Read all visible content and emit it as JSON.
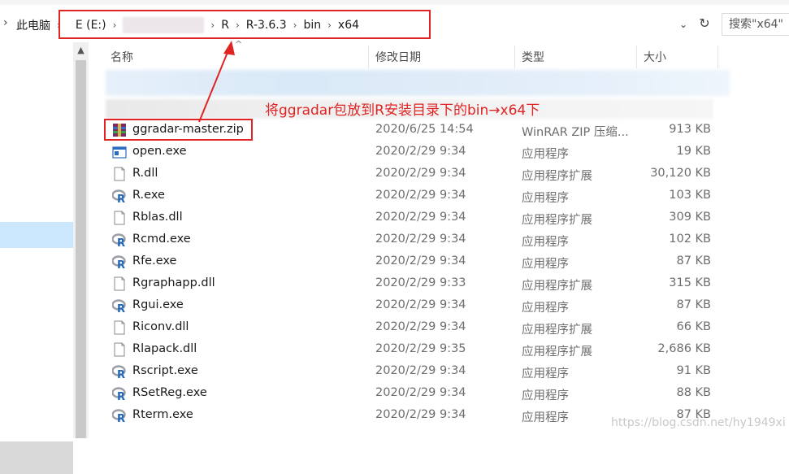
{
  "address_bar": {
    "crumbs": [
      "此电脑",
      "E (E:)",
      "R",
      "R-3.6.3",
      "bin",
      "x64"
    ],
    "search_placeholder": "搜索\"x64\""
  },
  "columns": {
    "name": "名称",
    "date": "修改日期",
    "type": "类型",
    "size": "大小"
  },
  "annotation": "将ggradar包放到R安装目录下的bin→x64下",
  "files": [
    {
      "name": "ggradar-master.zip",
      "date": "2020/6/25 14:54",
      "type": "WinRAR ZIP 压缩...",
      "size": "913 KB",
      "icon": "winrar-zip-icon"
    },
    {
      "name": "open.exe",
      "date": "2020/2/29 9:34",
      "type": "应用程序",
      "size": "19 KB",
      "icon": "window-exe-icon"
    },
    {
      "name": "R.dll",
      "date": "2020/2/29 9:34",
      "type": "应用程序扩展",
      "size": "30,120 KB",
      "icon": "dll-file-icon"
    },
    {
      "name": "R.exe",
      "date": "2020/2/29 9:34",
      "type": "应用程序",
      "size": "103 KB",
      "icon": "r-logo-icon"
    },
    {
      "name": "Rblas.dll",
      "date": "2020/2/29 9:34",
      "type": "应用程序扩展",
      "size": "309 KB",
      "icon": "dll-file-icon"
    },
    {
      "name": "Rcmd.exe",
      "date": "2020/2/29 9:34",
      "type": "应用程序",
      "size": "102 KB",
      "icon": "r-logo-icon"
    },
    {
      "name": "Rfe.exe",
      "date": "2020/2/29 9:34",
      "type": "应用程序",
      "size": "87 KB",
      "icon": "r-logo-icon"
    },
    {
      "name": "Rgraphapp.dll",
      "date": "2020/2/29 9:33",
      "type": "应用程序扩展",
      "size": "315 KB",
      "icon": "dll-file-icon"
    },
    {
      "name": "Rgui.exe",
      "date": "2020/2/29 9:34",
      "type": "应用程序",
      "size": "87 KB",
      "icon": "r-logo-icon"
    },
    {
      "name": "Riconv.dll",
      "date": "2020/2/29 9:34",
      "type": "应用程序扩展",
      "size": "66 KB",
      "icon": "dll-file-icon"
    },
    {
      "name": "Rlapack.dll",
      "date": "2020/2/29 9:35",
      "type": "应用程序扩展",
      "size": "2,686 KB",
      "icon": "dll-file-icon"
    },
    {
      "name": "Rscript.exe",
      "date": "2020/2/29 9:34",
      "type": "应用程序",
      "size": "91 KB",
      "icon": "r-logo-icon"
    },
    {
      "name": "RSetReg.exe",
      "date": "2020/2/29 9:34",
      "type": "应用程序",
      "size": "88 KB",
      "icon": "r-logo-icon"
    },
    {
      "name": "Rterm.exe",
      "date": "2020/2/29 9:34",
      "type": "应用程序",
      "size": "87 KB",
      "icon": "r-logo-icon"
    }
  ],
  "watermark": "https://blog.csdn.net/hy1949xi",
  "colors": {
    "highlight": "#e02424",
    "selection": "#cce8ff"
  }
}
